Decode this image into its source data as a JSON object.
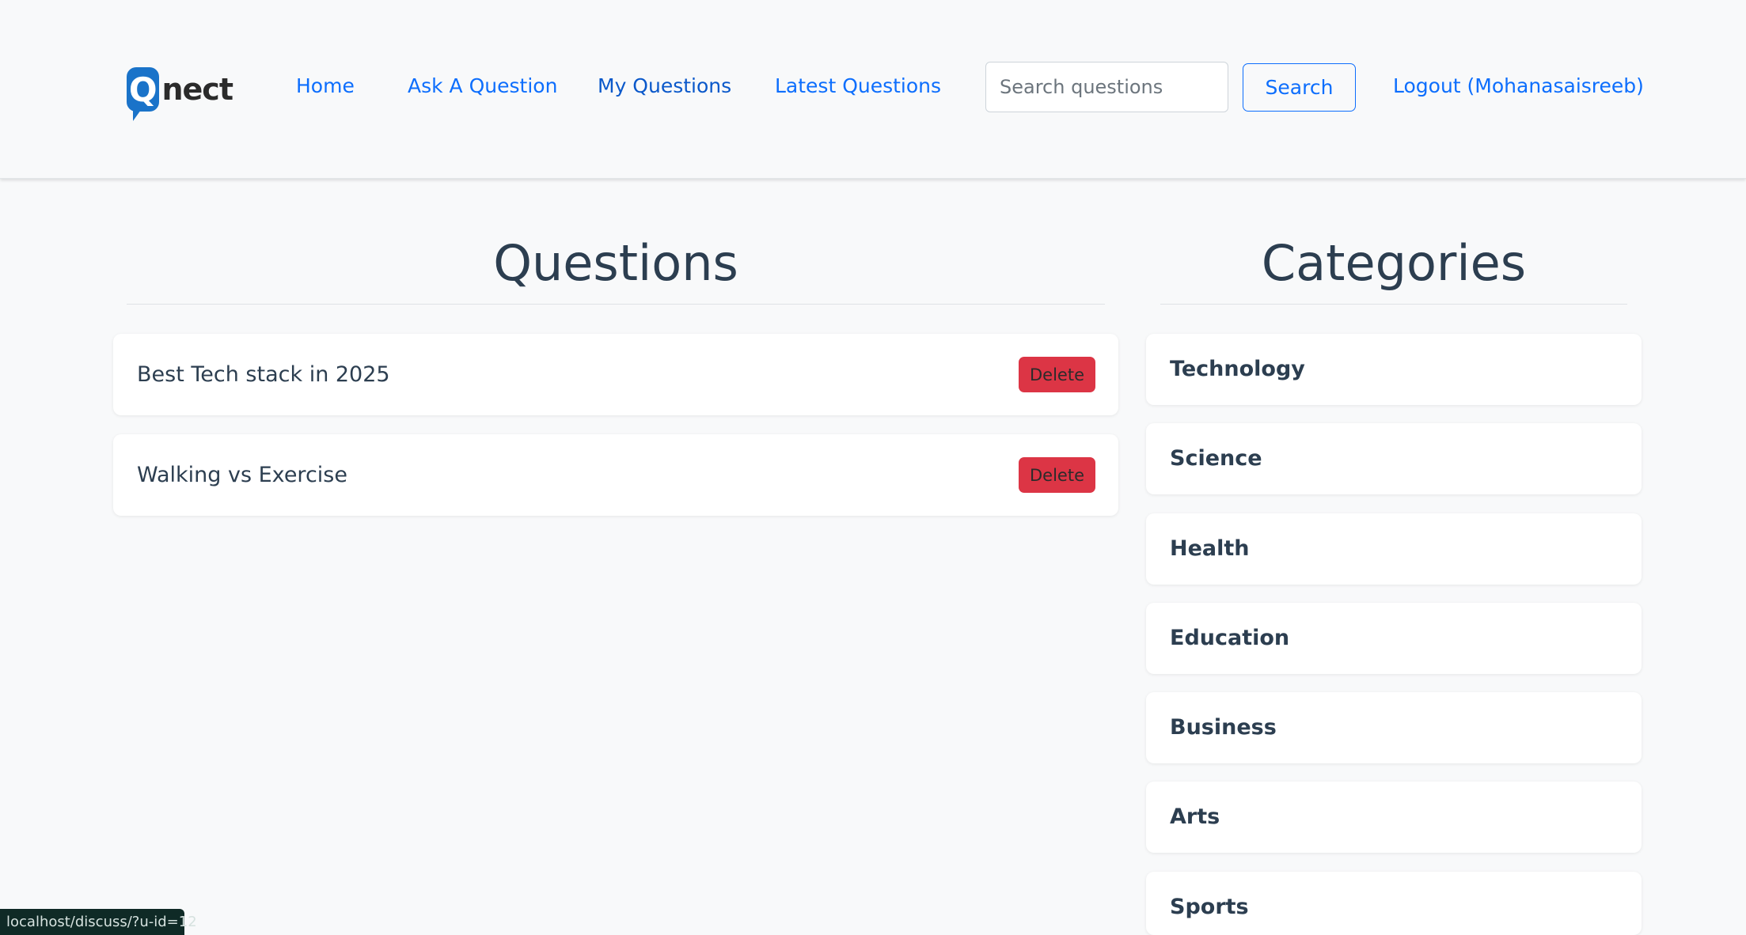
{
  "brand": {
    "logo_letter": "Q",
    "logo_rest": "nect",
    "accent": "#1a73c9"
  },
  "nav": {
    "home": "Home",
    "ask": "Ask A Question",
    "my_questions": "My Questions",
    "latest": "Latest Questions",
    "search_placeholder": "Search questions",
    "search_button": "Search",
    "logout": "Logout (Mohanasaisreeb)"
  },
  "questions": {
    "heading": "Questions",
    "items": [
      {
        "title": "Best Tech stack in 2025",
        "delete_label": "Delete"
      },
      {
        "title": "Walking vs Exercise",
        "delete_label": "Delete"
      }
    ]
  },
  "categories": {
    "heading": "Categories",
    "items": [
      "Technology",
      "Science",
      "Health",
      "Education",
      "Business",
      "Arts",
      "Sports"
    ]
  },
  "status_url": "localhost/discuss/?u-id=12",
  "colors": {
    "link": "#0d6efd",
    "danger": "#dc3545",
    "text": "#2c3e50",
    "background": "#f8f9fa"
  }
}
